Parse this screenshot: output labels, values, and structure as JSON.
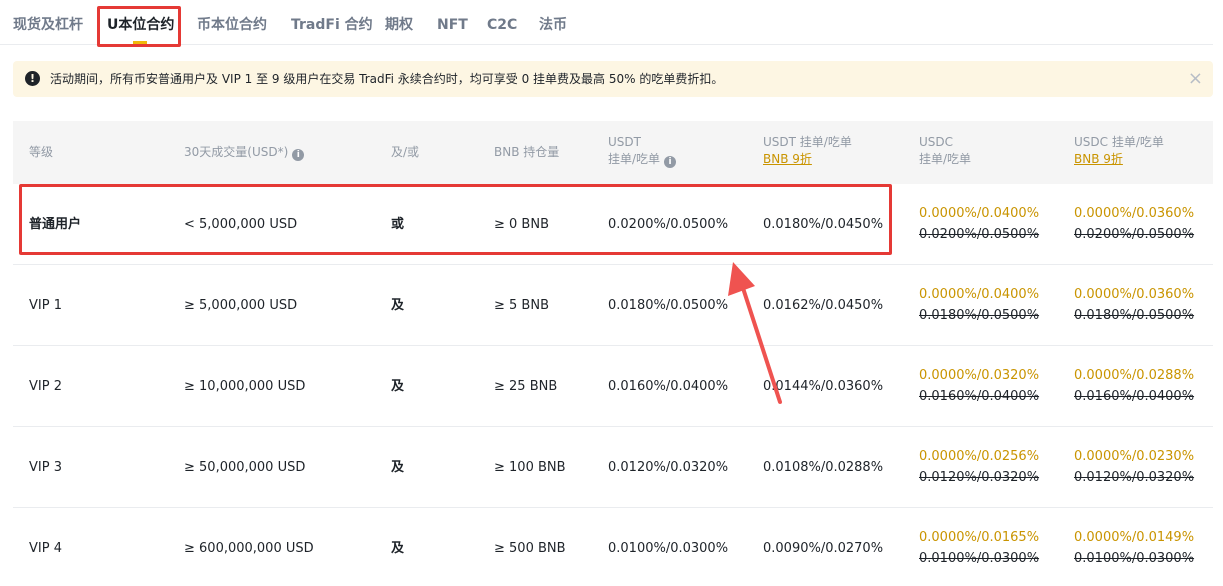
{
  "tabs": [
    {
      "label": "现货及杠杆"
    },
    {
      "label": "U本位合约"
    },
    {
      "label": "币本位合约"
    },
    {
      "label": "TradFi 合约"
    },
    {
      "label": "期权"
    },
    {
      "label": "NFT"
    },
    {
      "label": "C2C"
    },
    {
      "label": "法币"
    }
  ],
  "notice": {
    "icon": "!",
    "text": "活动期间，所有币安普通用户及 VIP 1 至 9 级用户在交易 TradFi 永续合约时，均可享受 0 挂单费及最高 50% 的吃单费折扣。",
    "close": "×"
  },
  "table": {
    "headers": {
      "level": "等级",
      "volume": "30天成交量(USD*)",
      "andor": "及/或",
      "bnb": "BNB 持仓量",
      "usdt_l1": "USDT",
      "usdt_l2": "挂单/吃单",
      "usdtbnb_l1": "USDT 挂单/吃单",
      "usdtbnb_l2": "BNB 9折",
      "usdc_l1": "USDC",
      "usdc_l2": "挂单/吃单",
      "usdcbnb_l1": "USDC 挂单/吃单",
      "usdcbnb_l2": "BNB 9折"
    },
    "rows": [
      {
        "level": "普通用户",
        "volume": "< 5,000,000 USD",
        "andor": "或",
        "bnb": "≥ 0 BNB",
        "usdt": "0.0200%/0.0500%",
        "usdt_bnb": "0.0180%/0.0450%",
        "usdc_new": "0.0000%/0.0400%",
        "usdc_old": "0.0200%/0.0500%",
        "usdcbnb_new": "0.0000%/0.0360%",
        "usdcbnb_old": "0.0200%/0.0500%"
      },
      {
        "level": "VIP 1",
        "volume": "≥ 5,000,000 USD",
        "andor": "及",
        "bnb": "≥ 5 BNB",
        "usdt": "0.0180%/0.0500%",
        "usdt_bnb": "0.0162%/0.0450%",
        "usdc_new": "0.0000%/0.0400%",
        "usdc_old": "0.0180%/0.0500%",
        "usdcbnb_new": "0.0000%/0.0360%",
        "usdcbnb_old": "0.0180%/0.0500%"
      },
      {
        "level": "VIP 2",
        "volume": "≥ 10,000,000 USD",
        "andor": "及",
        "bnb": "≥ 25 BNB",
        "usdt": "0.0160%/0.0400%",
        "usdt_bnb": "0.0144%/0.0360%",
        "usdc_new": "0.0000%/0.0320%",
        "usdc_old": "0.0160%/0.0400%",
        "usdcbnb_new": "0.0000%/0.0288%",
        "usdcbnb_old": "0.0160%/0.0400%"
      },
      {
        "level": "VIP 3",
        "volume": "≥ 50,000,000 USD",
        "andor": "及",
        "bnb": "≥ 100 BNB",
        "usdt": "0.0120%/0.0320%",
        "usdt_bnb": "0.0108%/0.0288%",
        "usdc_new": "0.0000%/0.0256%",
        "usdc_old": "0.0120%/0.0320%",
        "usdcbnb_new": "0.0000%/0.0230%",
        "usdcbnb_old": "0.0120%/0.0320%"
      },
      {
        "level": "VIP 4",
        "volume": "≥ 600,000,000 USD",
        "andor": "及",
        "bnb": "≥ 500 BNB",
        "usdt": "0.0100%/0.0300%",
        "usdt_bnb": "0.0090%/0.0270%",
        "usdc_new": "0.0000%/0.0165%",
        "usdc_old": "0.0100%/0.0300%",
        "usdcbnb_new": "0.0000%/0.0149%",
        "usdcbnb_old": "0.0100%/0.0300%"
      }
    ]
  },
  "colors": {
    "accent": "#f0b90b",
    "discount_text": "#c99400",
    "annotation_red": "#e53935",
    "notice_bg": "#fdf6e3"
  }
}
